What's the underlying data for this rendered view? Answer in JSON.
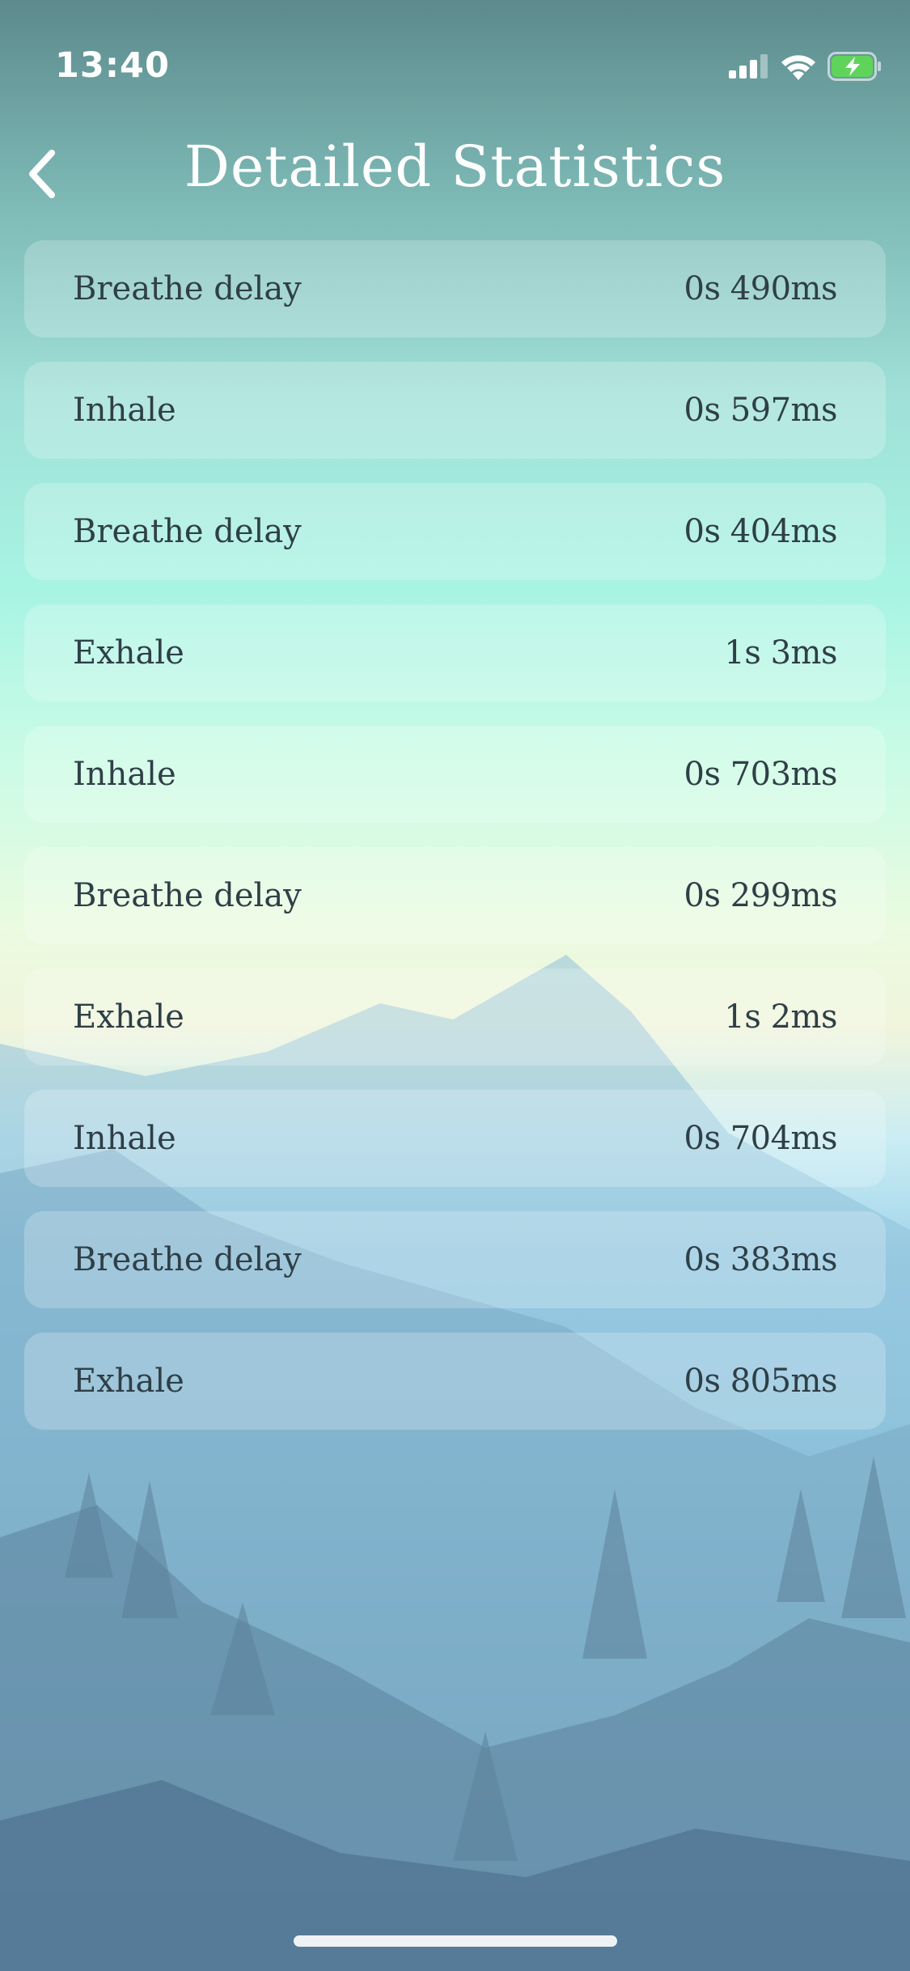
{
  "status_bar": {
    "time": "13:40",
    "icons": [
      "signal-icon",
      "wifi-icon",
      "battery-charging-icon"
    ]
  },
  "header": {
    "title": "Detailed Statistics",
    "back_icon": "chevron-left-icon"
  },
  "stats": [
    {
      "label": "Breathe delay",
      "value": "0s 490ms"
    },
    {
      "label": "Inhale",
      "value": "0s 597ms"
    },
    {
      "label": "Breathe delay",
      "value": "0s 404ms"
    },
    {
      "label": "Exhale",
      "value": "1s 3ms"
    },
    {
      "label": "Inhale",
      "value": "0s 703ms"
    },
    {
      "label": "Breathe delay",
      "value": "0s 299ms"
    },
    {
      "label": "Exhale",
      "value": "1s 2ms"
    },
    {
      "label": "Inhale",
      "value": "0s 704ms"
    },
    {
      "label": "Breathe delay",
      "value": "0s 383ms"
    },
    {
      "label": "Exhale",
      "value": "0s 805ms"
    }
  ],
  "colors": {
    "text": "#2f3f47",
    "title": "#ffffff",
    "battery_fill": "#5fd35a"
  }
}
